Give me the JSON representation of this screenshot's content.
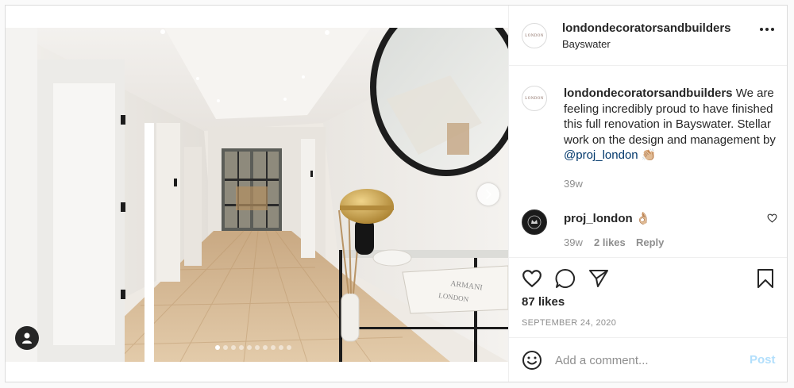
{
  "post": {
    "account": {
      "username": "londondecoratorsandbuilders",
      "location": "Bayswater",
      "avatar_text": "LONDON"
    },
    "media": {
      "slide_count": 10,
      "active_slide": 1,
      "book_text_1": "ARMANI",
      "book_text_2": "LONDON"
    },
    "caption": {
      "username": "londondecoratorsandbuilders",
      "text": "We are feeling incredibly proud to have finished this full renovation in Bayswater. Stellar work on the design and management by",
      "mention": "@proj_london",
      "emoji": "👏🏼",
      "age": "39w"
    },
    "comment": {
      "username": "proj_london",
      "emoji": "👌🏼",
      "age": "39w",
      "likes": "2 likes",
      "reply_label": "Reply"
    },
    "stats": {
      "likes": "87 likes",
      "date": "SEPTEMBER 24, 2020"
    },
    "add_comment": {
      "placeholder": "Add a comment...",
      "post_label": "Post"
    },
    "colors": {
      "link": "#00376b",
      "post_button": "#b2dffc",
      "muted": "#8e8e8e",
      "text": "#262626"
    }
  }
}
